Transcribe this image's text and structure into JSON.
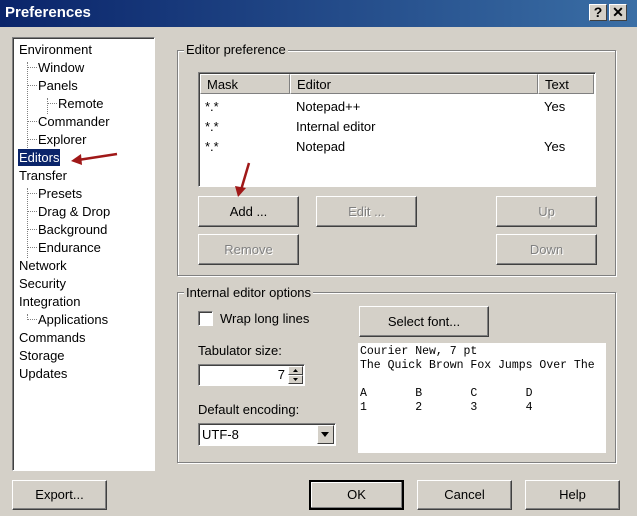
{
  "window": {
    "title": "Preferences",
    "help_glyph": "?",
    "close_glyph": "✕"
  },
  "tree": {
    "items": [
      {
        "label": "Environment",
        "level": 0
      },
      {
        "label": "Window",
        "level": 1
      },
      {
        "label": "Panels",
        "level": 1
      },
      {
        "label": "Remote",
        "level": 2
      },
      {
        "label": "Commander",
        "level": 1
      },
      {
        "label": "Explorer",
        "level": 1
      },
      {
        "label": "Editors",
        "level": 0,
        "selected": true
      },
      {
        "label": "Transfer",
        "level": 0
      },
      {
        "label": "Presets",
        "level": 1
      },
      {
        "label": "Drag & Drop",
        "level": 1
      },
      {
        "label": "Background",
        "level": 1
      },
      {
        "label": "Endurance",
        "level": 1
      },
      {
        "label": "Network",
        "level": 0
      },
      {
        "label": "Security",
        "level": 0
      },
      {
        "label": "Integration",
        "level": 0
      },
      {
        "label": "Applications",
        "level": 1
      },
      {
        "label": "Commands",
        "level": 0
      },
      {
        "label": "Storage",
        "level": 0
      },
      {
        "label": "Updates",
        "level": 0
      }
    ]
  },
  "editor_pref": {
    "group_title": "Editor preference",
    "columns": [
      "Mask",
      "Editor",
      "Text"
    ],
    "rows": [
      {
        "mask": "*.*",
        "editor": "Notepad++",
        "text": "Yes"
      },
      {
        "mask": "*.*",
        "editor": "Internal editor",
        "text": ""
      },
      {
        "mask": "*.*",
        "editor": "Notepad",
        "text": "Yes"
      }
    ],
    "buttons": {
      "add": "Add ...",
      "edit": "Edit ...",
      "up": "Up",
      "remove": "Remove",
      "down": "Down"
    }
  },
  "internal": {
    "group_title": "Internal editor options",
    "wrap_label": "Wrap long lines",
    "wrap_checked": false,
    "select_font": "Select font...",
    "tab_label": "Tabulator size:",
    "tab_value": "7",
    "encoding_label": "Default encoding:",
    "encoding_value": "UTF-8",
    "preview": {
      "line1": "Courier New, 7 pt",
      "line2": "The Quick Brown Fox Jumps Over The",
      "line3": "",
      "line4": "A       B       C       D",
      "line5": "1       2       3       4"
    }
  },
  "footer": {
    "export": "Export...",
    "ok": "OK",
    "cancel": "Cancel",
    "help": "Help"
  },
  "colors": {
    "face": "#d4d0c8",
    "title_start": "#0a246a",
    "title_end": "#3a6ea5",
    "selection": "#0a246a",
    "annotation_arrow": "#a01818"
  }
}
